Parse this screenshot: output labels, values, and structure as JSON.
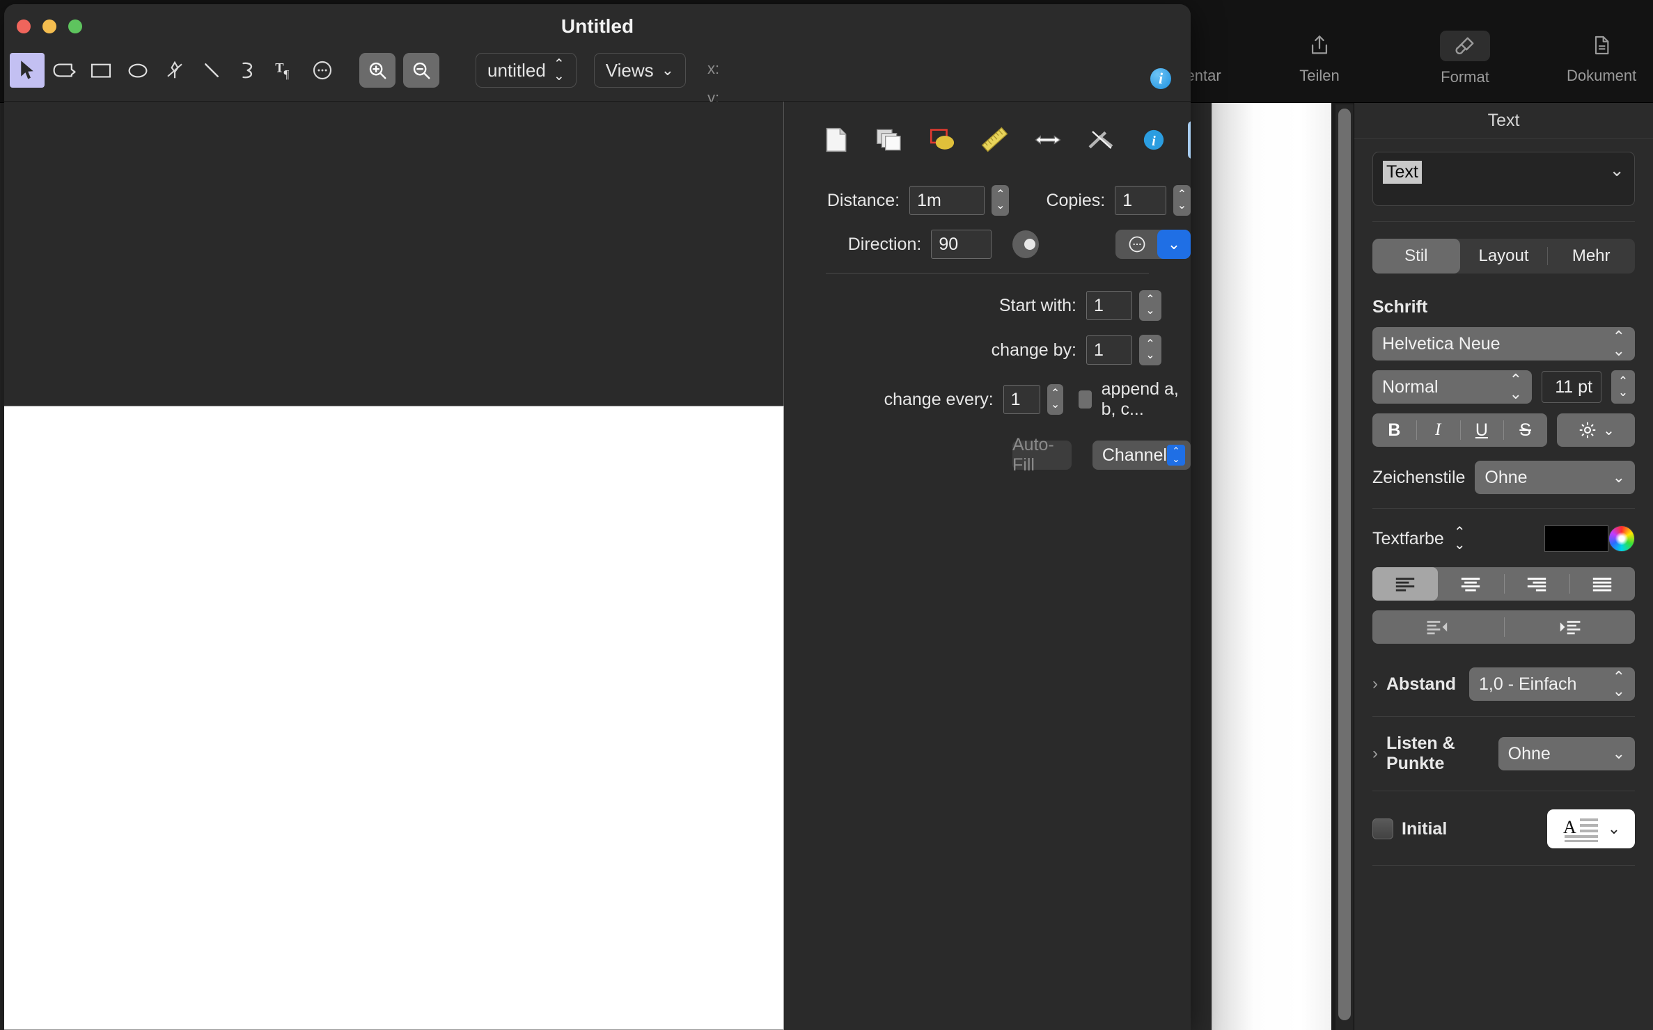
{
  "background_app": {
    "toolbar": {
      "items": [
        {
          "label": "Kommentar",
          "icon": "comment-icon",
          "active": false
        },
        {
          "label": "Teilen",
          "icon": "share-icon",
          "active": false
        },
        {
          "label": "Format",
          "icon": "paintbrush-icon",
          "active": true
        },
        {
          "label": "Dokument",
          "icon": "document-icon",
          "active": false
        }
      ]
    },
    "sidebar": {
      "title": "Text",
      "object_select": {
        "value": "Text",
        "chevron": "chevron-down-icon"
      },
      "tabs": [
        {
          "label": "Stil",
          "selected": true
        },
        {
          "label": "Layout",
          "selected": false
        },
        {
          "label": "Mehr",
          "selected": false
        }
      ],
      "font_section": {
        "heading": "Schrift",
        "family": "Helvetica Neue",
        "weight": "Normal",
        "size": "11 pt",
        "styles": [
          {
            "label": "B",
            "name": "bold"
          },
          {
            "label": "I",
            "name": "italic"
          },
          {
            "label": "U",
            "name": "underline"
          },
          {
            "label": "S",
            "name": "strikethrough"
          }
        ],
        "gear_icon": "gear-icon",
        "char_styles_label": "Zeichenstile",
        "char_styles_value": "Ohne"
      },
      "text_color": {
        "label": "Textfarbe",
        "swatch": "#000000",
        "wheel_icon": "color-wheel-icon"
      },
      "alignment": [
        {
          "name": "align-left",
          "selected": true
        },
        {
          "name": "align-center",
          "selected": false
        },
        {
          "name": "align-right",
          "selected": false
        },
        {
          "name": "align-justify",
          "selected": false
        }
      ],
      "indent": [
        {
          "name": "outdent",
          "selected": false
        },
        {
          "name": "indent",
          "selected": false
        }
      ],
      "spacing": {
        "label": "Abstand",
        "value": "1,0 - Einfach",
        "disclosure": "chevron-right-icon"
      },
      "lists": {
        "label": "Listen & Punkte",
        "value": "Ohne",
        "disclosure": "chevron-right-icon"
      },
      "drop_cap": {
        "label": "Initial",
        "checked": false,
        "preview": "drop-cap-preview"
      }
    }
  },
  "foreground_window": {
    "title": "Untitled",
    "traffic_lights": [
      "close",
      "minimize",
      "zoom"
    ],
    "tools": [
      {
        "name": "select-arrow-tool",
        "selected": true
      },
      {
        "name": "freeform-shape-tool",
        "selected": false
      },
      {
        "name": "rectangle-tool",
        "selected": false
      },
      {
        "name": "ellipse-tool",
        "selected": false
      },
      {
        "name": "pen-tool",
        "selected": false
      },
      {
        "name": "line-tool",
        "selected": false
      },
      {
        "name": "curve-tool",
        "selected": false
      },
      {
        "name": "text-tool",
        "selected": false
      },
      {
        "name": "more-tools",
        "selected": false
      }
    ],
    "zoom_in_label": "zoom-in",
    "zoom_out_label": "zoom-out",
    "layer_popup": "untitled",
    "views_menu": "Views",
    "coord_x_label": "x:",
    "coord_y_label": "y:",
    "info_button": "i",
    "inspector": {
      "icons": [
        {
          "name": "page-inspector",
          "selected": false
        },
        {
          "name": "layers-inspector",
          "selected": false
        },
        {
          "name": "shape-inspector",
          "selected": false
        },
        {
          "name": "dimension-inspector",
          "selected": false
        },
        {
          "name": "arrow-inspector",
          "selected": false
        },
        {
          "name": "line-inspector",
          "selected": false
        },
        {
          "name": "info-inspector",
          "selected": false
        },
        {
          "name": "tools-inspector",
          "selected": true
        },
        {
          "name": "color-inspector",
          "selected": false
        }
      ],
      "duplicate": {
        "distance_label": "Distance:",
        "distance_value": "1m",
        "copies_label": "Copies:",
        "copies_value": "1",
        "direction_label": "Direction:",
        "direction_value": "90",
        "options_icon": "ellipsis-icon",
        "options_chevron": "chevron-down-icon"
      },
      "autofill": {
        "start_with_label": "Start with:",
        "start_with_value": "1",
        "change_by_label": "change by:",
        "change_by_value": "1",
        "change_every_label": "change every:",
        "change_every_value": "1",
        "append_label": "append a, b, c...",
        "append_checked": false,
        "button_label": "Auto-Fill",
        "button_disabled": true,
        "channel_value": "Channel"
      }
    }
  },
  "colors": {
    "accent_blue": "#1f6fe5",
    "tool_selected": "#c3c0f2",
    "inspector_selected": "#a8cdf0",
    "window_bg": "#2b2b2b",
    "sidebar_bg": "#2b2b2b"
  }
}
